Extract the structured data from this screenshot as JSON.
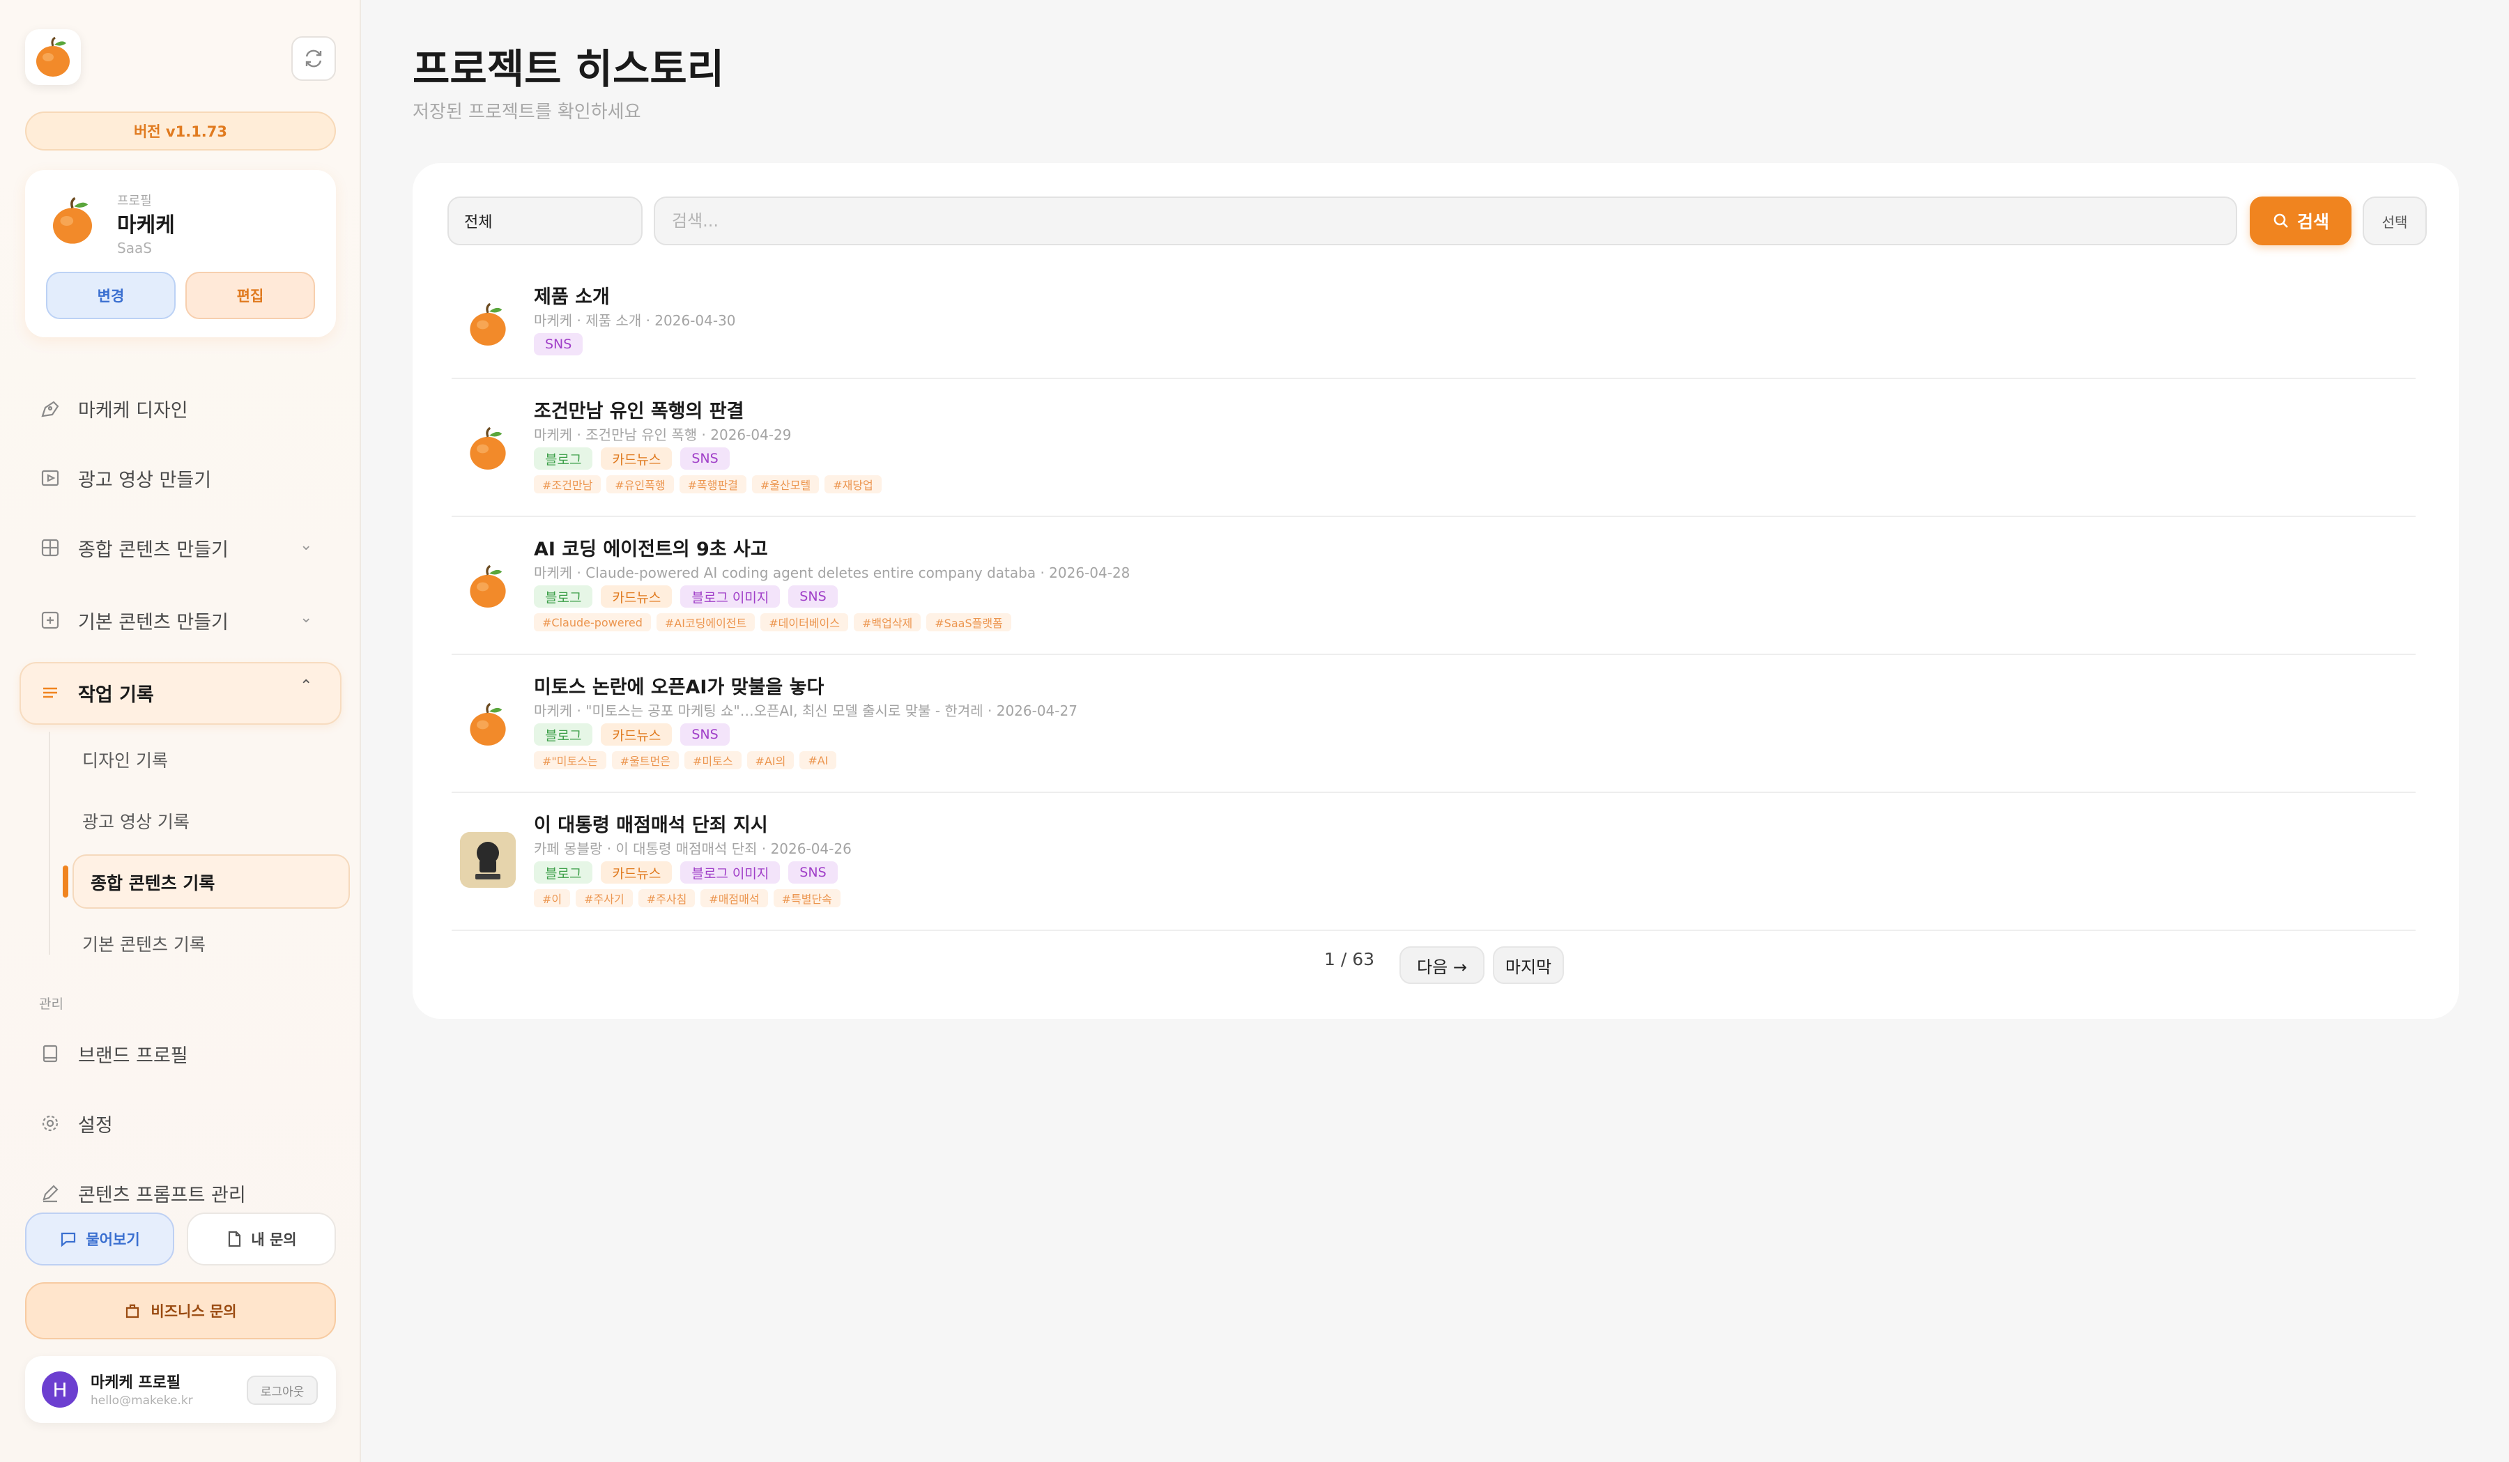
{
  "sidebar": {
    "version": "버전 v1.1.73",
    "profile": {
      "label": "프로필",
      "name": "마케케",
      "sub": "SaaS",
      "change_label": "변경",
      "edit_label": "편집"
    },
    "nav": [
      {
        "label": "마케케 디자인",
        "icon": "pen-tool-icon"
      },
      {
        "label": "광고 영상 만들기",
        "icon": "video-icon"
      },
      {
        "label": "종합 콘텐츠 만들기",
        "icon": "grid-icon"
      },
      {
        "label": "기본 콘텐츠 만들기",
        "icon": "plus-square-icon"
      },
      {
        "label": "작업 기록",
        "icon": "list-icon"
      }
    ],
    "sub_items": [
      "디자인 기록",
      "광고 영상 기록",
      "종합 콘텐츠 기록",
      "기본 콘텐츠 기록"
    ],
    "section_label": "관리",
    "manage": [
      {
        "label": "브랜드 프로필",
        "icon": "book-icon"
      },
      {
        "label": "설정",
        "icon": "gear-icon"
      },
      {
        "label": "콘텐츠 프롬프트 관리",
        "icon": "pencil-icon"
      }
    ],
    "ask_label": "물어보기",
    "myq_label": "내 문의",
    "biz_label": "비즈니스 문의",
    "user": {
      "initial": "H",
      "name": "마케케 프로필",
      "email": "hello@makeke.kr",
      "logout_label": "로그아웃"
    }
  },
  "main": {
    "title": "프로젝트 히스토리",
    "subtitle": "저장된 프로젝트를 확인하세요",
    "filter_value": "전체",
    "search_placeholder": "검색...",
    "search_label": "검색",
    "select_label": "선택",
    "items": [
      {
        "title": "제품 소개",
        "meta": "마케케 · 제품 소개 · 2026-04-30",
        "tags": [
          {
            "label": "SNS",
            "kind": "sns"
          }
        ],
        "hashes": [],
        "thumb": "tangerine"
      },
      {
        "title": "조건만남 유인 폭행의 판결",
        "meta": "마케케 · 조건만남 유인 폭행 · 2026-04-29",
        "tags": [
          {
            "label": "블로그",
            "kind": "blog"
          },
          {
            "label": "카드뉴스",
            "kind": "card"
          },
          {
            "label": "SNS",
            "kind": "sns"
          }
        ],
        "hashes": [
          "#조건만남",
          "#유인폭행",
          "#폭행판결",
          "#울산모텔",
          "#재당업"
        ],
        "thumb": "tangerine"
      },
      {
        "title": "AI 코딩 에이전트의 9초 사고",
        "meta": "마케케 · Claude-powered AI coding agent deletes entire company databa · 2026-04-28",
        "tags": [
          {
            "label": "블로그",
            "kind": "blog"
          },
          {
            "label": "카드뉴스",
            "kind": "card"
          },
          {
            "label": "블로그 이미지",
            "kind": "img"
          },
          {
            "label": "SNS",
            "kind": "sns"
          }
        ],
        "hashes": [
          "#Claude-powered",
          "#AI코딩에이전트",
          "#데이터베이스",
          "#백업삭제",
          "#SaaS플랫폼"
        ],
        "thumb": "tangerine"
      },
      {
        "title": "미토스 논란에 오픈AI가 맞불을 놓다",
        "meta": "마케케 · \"미토스는 공포 마케팅 쇼\"…오픈AI, 최신 모델 출시로 맞불 - 한겨레 · 2026-04-27",
        "tags": [
          {
            "label": "블로그",
            "kind": "blog"
          },
          {
            "label": "카드뉴스",
            "kind": "card"
          },
          {
            "label": "SNS",
            "kind": "sns"
          }
        ],
        "hashes": [
          "#\"미토스는",
          "#울트먼은",
          "#미토스",
          "#AI의",
          "#AI"
        ],
        "thumb": "tangerine"
      },
      {
        "title": "이 대통령 매점매석 단죄 지시",
        "meta": "카페 몽블랑 · 이 대통령 매점매석 단죄 · 2026-04-26",
        "tags": [
          {
            "label": "블로그",
            "kind": "blog"
          },
          {
            "label": "카드뉴스",
            "kind": "card"
          },
          {
            "label": "블로그 이미지",
            "kind": "img"
          },
          {
            "label": "SNS",
            "kind": "sns"
          }
        ],
        "hashes": [
          "#이",
          "#주사기",
          "#주사침",
          "#매점매석",
          "#특별단속"
        ],
        "thumb": "cafe"
      }
    ],
    "pager": {
      "info": "1 / 63",
      "next_label": "다음 →",
      "last_label": "마지막"
    }
  },
  "colors": {
    "accent": "#f0841f",
    "blue": "#3a6fd0"
  }
}
